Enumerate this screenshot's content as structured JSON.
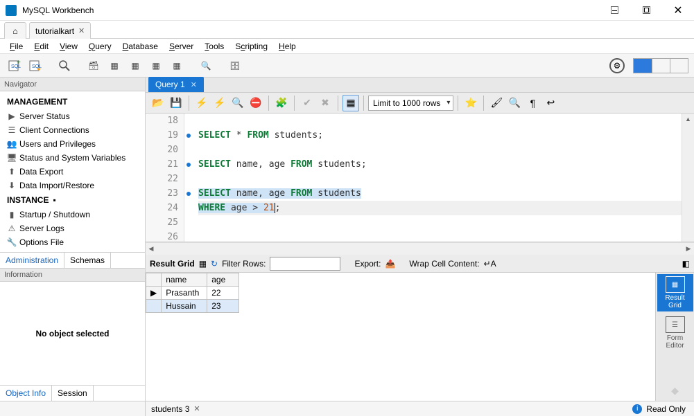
{
  "window": {
    "title": "MySQL Workbench"
  },
  "connectionTab": {
    "label": "tutorialkart"
  },
  "menubar": {
    "file": "File",
    "edit": "Edit",
    "view": "View",
    "query": "Query",
    "database": "Database",
    "server": "Server",
    "tools": "Tools",
    "scripting": "Scripting",
    "help": "Help"
  },
  "navigator": {
    "header": "Navigator",
    "management": {
      "title": "MANAGEMENT",
      "items": [
        "Server Status",
        "Client Connections",
        "Users and Privileges",
        "Status and System Variables",
        "Data Export",
        "Data Import/Restore"
      ]
    },
    "instance": {
      "title": "INSTANCE",
      "items": [
        "Startup / Shutdown",
        "Server Logs",
        "Options File"
      ]
    },
    "tabs": {
      "admin": "Administration",
      "schemas": "Schemas"
    }
  },
  "information": {
    "header": "Information",
    "body": "No object selected",
    "tabs": {
      "objectInfo": "Object Info",
      "session": "Session"
    }
  },
  "queryTab": {
    "label": "Query 1"
  },
  "editorToolbar": {
    "limit": "Limit to 1000 rows"
  },
  "code": {
    "lines": [
      {
        "n": "18",
        "dot": false
      },
      {
        "n": "19",
        "dot": true
      },
      {
        "n": "20",
        "dot": false
      },
      {
        "n": "21",
        "dot": true
      },
      {
        "n": "22",
        "dot": false
      },
      {
        "n": "23",
        "dot": true
      },
      {
        "n": "24",
        "dot": false
      },
      {
        "n": "25",
        "dot": false
      },
      {
        "n": "26",
        "dot": false
      }
    ],
    "l19": {
      "kw1": "SELECT",
      "star": " * ",
      "kw2": "FROM",
      "tbl": " students;"
    },
    "l21": {
      "kw1": "SELECT",
      "cols": " name, age ",
      "kw2": "FROM",
      "tbl": " students;"
    },
    "l23": {
      "kw1": "SELECT",
      "cols": " name, age ",
      "kw2": "FROM",
      "tbl": " students"
    },
    "l24": {
      "kw1": "WHERE",
      "col": " age > ",
      "num": "21",
      "semi": ";"
    }
  },
  "results": {
    "toolbar": {
      "gridLabel": "Result Grid",
      "filterLabel": "Filter Rows:",
      "exportLabel": "Export:",
      "wrapLabel": "Wrap Cell Content:"
    },
    "columns": [
      "name",
      "age"
    ],
    "rows": [
      {
        "name": "Prasanth",
        "age": "22"
      },
      {
        "name": "Hussain",
        "age": "23"
      }
    ],
    "sideTools": {
      "resultGrid": "Result\nGrid",
      "formEditor": "Form\nEditor"
    }
  },
  "status": {
    "resultTab": "students 3",
    "readOnly": "Read Only"
  }
}
